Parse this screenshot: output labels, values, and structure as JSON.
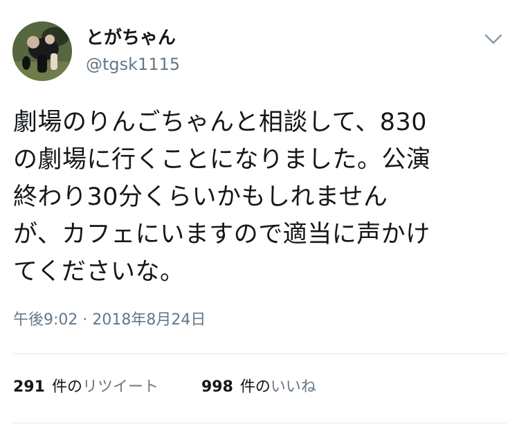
{
  "user": {
    "display_name": "とがちゃん",
    "handle": "@tgsk1115"
  },
  "tweet": {
    "text": "劇場のりんごちゃんと相談して、830\nの劇場に行くことになりました。公演\n終わり30分くらいかもしれません\nが、カフェにいますので適当に声かけ\nてくださいな。",
    "timestamp": "午後9:02 · 2018年8月24日"
  },
  "stats": {
    "retweets": {
      "count": "291",
      "unit": "件の",
      "label": "リツイート"
    },
    "likes": {
      "count": "998",
      "unit": "件の",
      "label": "いいね"
    }
  },
  "icons": {
    "menu": "chevron-down-icon"
  },
  "colors": {
    "text": "#14171a",
    "secondary": "#657786",
    "divider": "#e1e8ed"
  }
}
